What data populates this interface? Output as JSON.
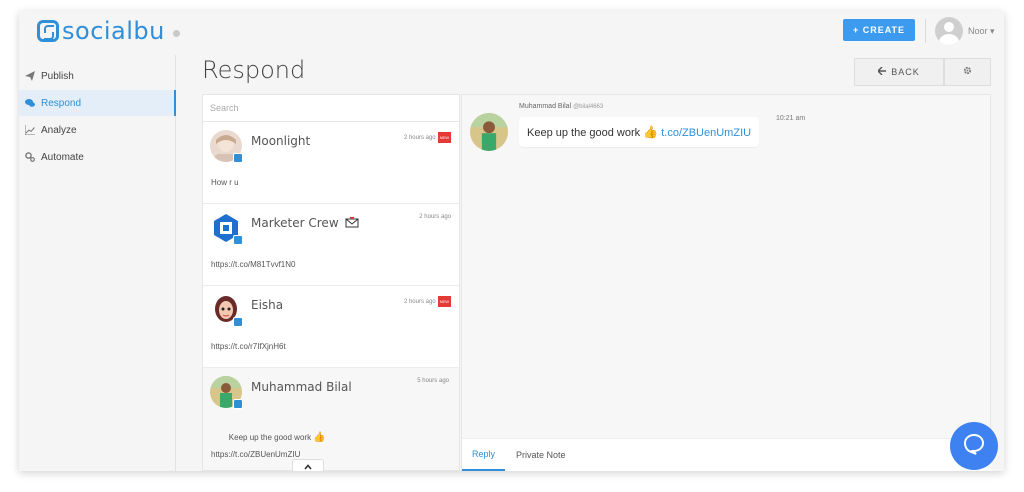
{
  "app": {
    "brand": "socialbu"
  },
  "header": {
    "create_label": "+ CREATE",
    "user_name": "Noor ▾"
  },
  "sidebar": {
    "items": [
      {
        "label": "Publish",
        "icon": "paper-plane-icon",
        "active": false
      },
      {
        "label": "Respond",
        "icon": "chat-bubbles-icon",
        "active": true
      },
      {
        "label": "Analyze",
        "icon": "line-chart-icon",
        "active": false
      },
      {
        "label": "Automate",
        "icon": "gears-icon",
        "active": false
      }
    ]
  },
  "page": {
    "title": "Respond",
    "back_label": "BACK"
  },
  "search": {
    "placeholder": "Search"
  },
  "conversations": [
    {
      "name": "Moonlight",
      "time": "2 hours ago",
      "badge": "NEW",
      "message": "How r u",
      "active": false
    },
    {
      "name": "Marketer Crew",
      "time": "2 hours ago",
      "badge": "",
      "message": "https://t.co/M81Tvvf1N0",
      "active": false
    },
    {
      "name": "Eisha",
      "time": "2 hours ago",
      "badge": "NEW",
      "message": "https://t.co/r7IfXjnH6t",
      "active": false
    },
    {
      "name": "Muhammad Bilal",
      "time": "5 hours ago",
      "badge": "",
      "message_line1": "Keep up the good work",
      "message_line2": "https://t.co/ZBUenUmZIU",
      "active": true
    }
  ],
  "thread": {
    "author": "Muhammad Bilal",
    "handle": "@bilal4663",
    "text": "Keep up the good work",
    "link": "t.co/ZBUenUmZIU",
    "time": "10:21 am"
  },
  "reply_tabs": [
    {
      "label": "Reply",
      "active": true
    },
    {
      "label": "Private Note",
      "active": false
    }
  ],
  "colors": {
    "accent": "#2f8fd8",
    "create_button": "#3d9bef",
    "new_badge": "#e53935",
    "chat_fab": "#3d82f0"
  }
}
